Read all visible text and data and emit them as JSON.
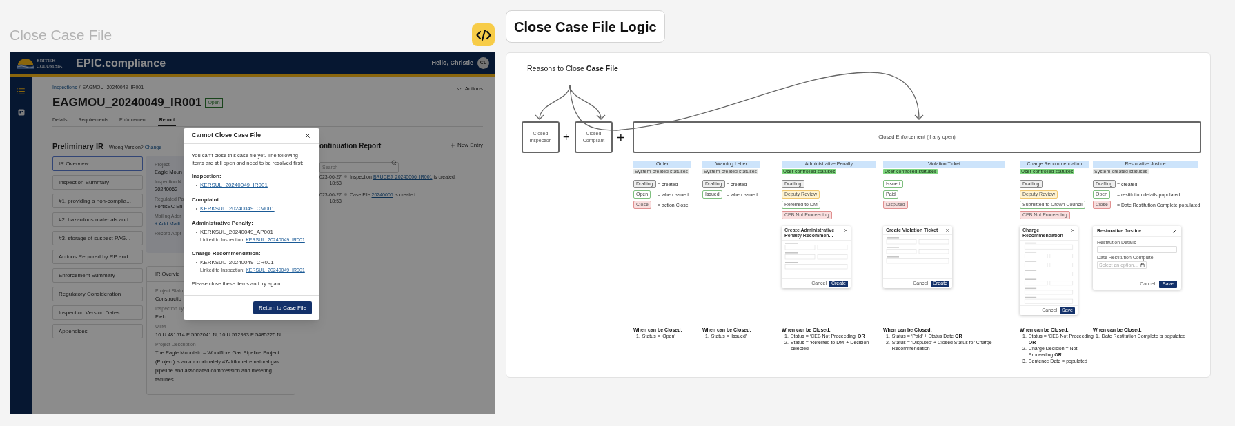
{
  "left": {
    "title": "Close Case File"
  },
  "app": {
    "brand": {
      "logo_lines": [
        "BRITISH",
        "COLUMBIA"
      ],
      "name": "EPIC.compliance"
    },
    "greeting": "Hello, Christie",
    "avatar": "CL",
    "breadcrumb": {
      "link": "Inspections",
      "separator": "/",
      "current": "EAGMOU_20240049_IR001"
    },
    "title": "EAGMOU_20240049_IR001",
    "status": "Open",
    "actions": "Actions",
    "tabs": [
      {
        "label": "Details",
        "selected": false
      },
      {
        "label": "Requirements",
        "selected": false
      },
      {
        "label": "Enforcement",
        "selected": false
      },
      {
        "label": "Report",
        "selected": true
      }
    ],
    "preliminary": {
      "heading": "Preliminary IR",
      "wrong_version": "Wrong Version?",
      "change_link": "Change"
    },
    "nav": [
      {
        "label": "IR Overview",
        "selected": true
      },
      {
        "label": "Inspection Summary",
        "selected": false
      },
      {
        "label": "#1. providing a non-complia...",
        "selected": false
      },
      {
        "label": "#2. hazardous materials and...",
        "selected": false
      },
      {
        "label": "#3. storage of suspect PAG...",
        "selected": false
      },
      {
        "label": "Actions Required by RP and...",
        "selected": false
      },
      {
        "label": "Enforcement Summary",
        "selected": false
      },
      {
        "label": "Regulatory Consideration",
        "selected": false
      },
      {
        "label": "Inspection Version Dates",
        "selected": false
      },
      {
        "label": "Appendices",
        "selected": false
      }
    ],
    "project_card": [
      {
        "label": "Project",
        "value": "Eagle Moun"
      },
      {
        "label": "Inspection N",
        "value": "20240062_I"
      },
      {
        "label": "Regulated Pa",
        "value": "FortisBC En"
      },
      {
        "label": "Mailing Addr",
        "value": "+ Add Maili",
        "kind": "link"
      },
      {
        "label": "Record Appr"
      }
    ],
    "overview_card": {
      "title": "IR Overvie",
      "fields": [
        {
          "label": "Project Statu",
          "value": "Constructio"
        },
        {
          "label": "Inspection Ty",
          "value": "Field"
        },
        {
          "label": "UTM",
          "value": "10 U 481514 E 5502041 N, 10 U 512993 E 5485225 N"
        },
        {
          "label": "Project Description",
          "value": "The Eagle Mountain – Woodfibre Gas Pipeline Project (Project) is an approximately 47- kilometre natural gas pipeline and associated compression and metering facilities."
        }
      ]
    },
    "continuation": {
      "title": "ontinuation Report",
      "new_entry": "New Entry",
      "search": {
        "placeholder": "Search"
      },
      "entries": [
        {
          "date": "023-06-27",
          "time": "18:53",
          "before": "Inspection",
          "link": "BRUCEJ_20240006_IR001",
          "after": "is created."
        },
        {
          "date": "023-06-27",
          "time": "18:53",
          "before": "Case File",
          "link": "20240006",
          "after": "is created."
        }
      ]
    }
  },
  "modal": {
    "title": "Cannot Close Case File",
    "intro": "You can’t close this case file yet. The following items are still open and need to be resolved first:",
    "groups": [
      {
        "heading": "Inspection:",
        "items": [
          {
            "id": "KERSUL_20240049_IR001",
            "link": true
          }
        ]
      },
      {
        "heading": "Complaint:",
        "items": [
          {
            "id": "KERKSUL_20240049_CM001",
            "link": true
          }
        ]
      },
      {
        "heading": "Administrative Penalty:",
        "items": [
          {
            "id": "KERKSUL_20240049_AP001",
            "link": false,
            "linked_label": "Linked to Inspection:",
            "linked_id": "KERSUL_20240049_IR001"
          }
        ]
      },
      {
        "heading": "Charge Recommendation:",
        "items": [
          {
            "id": "KERKSUL_20240049_CR001",
            "link": false,
            "linked_label": "Linked to Inspection:",
            "linked_id": "KERSUL_20240049_IR001"
          }
        ]
      }
    ],
    "outro": "Please close these items and try again.",
    "button": "Return to Case File"
  },
  "logic": {
    "title": "Close Case File Logic",
    "heading": "Reasons to Close **Case File**",
    "boxes": [
      {
        "label": "Closed Inspection"
      },
      {
        "label": "Closed Compliant"
      },
      {
        "label": "Closed Enforcement (if any open)"
      }
    ],
    "operators": [
      "+",
      "+"
    ],
    "columns": [
      {
        "title": "Order",
        "badge": {
          "kind": "system",
          "label": "System-created statuses"
        },
        "statuses": [
          {
            "label": "Drafting",
            "kind": "neutral",
            "note": "= created"
          },
          {
            "label": "Open",
            "kind": "success",
            "note": "= when issued"
          },
          {
            "label": "Close",
            "kind": "danger",
            "note": "= action Close"
          }
        ],
        "when": "When can be Closed:",
        "conditions": [
          {
            "n": "1.",
            "text": "Status = ‘Open’"
          }
        ]
      },
      {
        "title": "Warning Letter",
        "badge": {
          "kind": "system",
          "label": "System-created statuses"
        },
        "statuses": [
          {
            "label": "Drafting",
            "kind": "neutral",
            "note": "= created"
          },
          {
            "label": "Issued",
            "kind": "success",
            "note": "= when issued"
          }
        ],
        "when": "When can be Closed:",
        "conditions": [
          {
            "n": "1.",
            "text": "Status = ‘Issued’"
          }
        ]
      },
      {
        "title": "Administrative Penalty",
        "badge": {
          "kind": "user",
          "label": "User-controlled statuses"
        },
        "statuses": [
          {
            "label": "Drafting",
            "kind": "neutral"
          },
          {
            "label": "Deputy Review",
            "kind": "warning"
          },
          {
            "label": "Referred to DM",
            "kind": "success"
          },
          {
            "label": "CEB Not Proceeding",
            "kind": "danger"
          }
        ],
        "dialog": {
          "title": "Create Administrative Penalty Recommen...",
          "kind": "compact",
          "cancel": "Cancel",
          "primary": "Create"
        },
        "when": "When can be Closed:",
        "conditions": [
          {
            "n": "1.",
            "text": "Status = ‘CEB Not Proceeding’ **OR**"
          },
          {
            "n": "2.",
            "text": "Status = ‘Referred to DM’ + Decision selected"
          }
        ]
      },
      {
        "title": "Violation Ticket",
        "badge": {
          "kind": "user",
          "label": "User-controlled statuses"
        },
        "statuses": [
          {
            "label": "Issued",
            "kind": "success"
          },
          {
            "label": "Paid",
            "kind": "success"
          },
          {
            "label": "Disputed",
            "kind": "danger"
          }
        ],
        "dialog": {
          "title": "Create Violation Ticket",
          "kind": "compact",
          "cancel": "Cancel",
          "primary": "Create"
        },
        "when": "When can be Closed:",
        "conditions": [
          {
            "n": "1.",
            "text": "Status = ‘Paid’ + Status Date **OR**"
          },
          {
            "n": "2.",
            "text": "Status = ‘Disputed’ + Closed Status for Charge Recommendation"
          }
        ]
      },
      {
        "title": "Charge Recommendation",
        "badge": {
          "kind": "user",
          "label": "User-controlled statuses"
        },
        "statuses": [
          {
            "label": "Drafting",
            "kind": "neutral"
          },
          {
            "label": "Deputy Review",
            "kind": "warning"
          },
          {
            "label": "Submitted to Crown Council",
            "kind": "success"
          },
          {
            "label": "CEB Not Proceeding",
            "kind": "danger"
          }
        ],
        "dialog": {
          "title": "Charge Recommendation",
          "kind": "tall",
          "cancel": "Cancel",
          "primary": "Save"
        },
        "when": "When can be Closed:",
        "conditions": [
          {
            "n": "1.",
            "text": "Status = ‘CEB Not Proceeding’ **OR**"
          },
          {
            "n": "2.",
            "text": "Charge Decision = Not Proceeding **OR**"
          },
          {
            "n": "3.",
            "text": "Sentence Date = populated"
          }
        ]
      },
      {
        "title": "Restorative Justice",
        "badge": {
          "kind": "system",
          "label": "System-created statuses"
        },
        "statuses": [
          {
            "label": "Drafting",
            "kind": "neutral",
            "note": "= created"
          },
          {
            "label": "Open",
            "kind": "success",
            "note": "= restitution details populated"
          },
          {
            "label": "Close",
            "kind": "danger",
            "note": "= Date Restitution Complete populated"
          }
        ],
        "dialog": {
          "title": "Restorative Justice",
          "kind": "form",
          "fields": [
            {
              "label": "Restitution Details",
              "kind": "textarea"
            },
            {
              "label": "Date Restitution Complete",
              "kind": "date",
              "placeholder": "Select an option..."
            }
          ],
          "cancel": "Cancel",
          "primary": "Save"
        },
        "when": "When can be Closed:",
        "conditions": [
          {
            "n": "1.",
            "text": "Date Restitution Complete is populated"
          }
        ]
      }
    ]
  }
}
